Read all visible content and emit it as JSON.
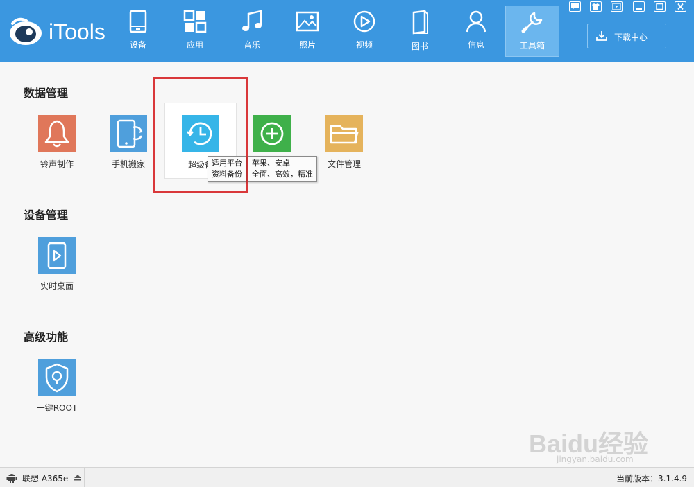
{
  "app": {
    "name": "iTools"
  },
  "nav": [
    {
      "label": "设备",
      "icon": "tablet-icon"
    },
    {
      "label": "应用",
      "icon": "apps-grid-icon"
    },
    {
      "label": "音乐",
      "icon": "music-note-icon"
    },
    {
      "label": "照片",
      "icon": "photo-icon"
    },
    {
      "label": "视频",
      "icon": "play-circle-icon"
    },
    {
      "label": "图书",
      "icon": "book-icon"
    },
    {
      "label": "信息",
      "icon": "person-icon"
    },
    {
      "label": "工具箱",
      "icon": "wrench-icon",
      "active": true
    }
  ],
  "window_controls": [
    "feedback-icon",
    "skin-icon",
    "dropdown-menu-icon",
    "minimize-icon",
    "maximize-icon",
    "close-icon"
  ],
  "download_center": {
    "label": "下载中心"
  },
  "sections": {
    "data_management": {
      "title": "数据管理",
      "tools": [
        {
          "label": "铃声制作",
          "icon": "bell-icon",
          "color": "#e0775a"
        },
        {
          "label": "手机搬家",
          "icon": "phone-transfer-icon",
          "color": "#4f9fdc"
        },
        {
          "label": "超级备",
          "icon": "clock-backup-icon",
          "color": "#36b5e8"
        },
        {
          "label": "",
          "icon": "plus-circle-icon",
          "color": "#3fb04a"
        },
        {
          "label": "文件管理",
          "icon": "folder-icon",
          "color": "#e5b35c"
        }
      ]
    },
    "device_management": {
      "title": "设备管理",
      "tools": [
        {
          "label": "实时桌面",
          "icon": "play-screen-icon",
          "color": "#4f9fdc"
        }
      ]
    },
    "advanced": {
      "title": "高级功能",
      "tools": [
        {
          "label": "一键ROOT",
          "icon": "shield-lock-icon",
          "color": "#4f9fdc"
        }
      ]
    }
  },
  "tooltips": {
    "backup": {
      "line1": "适用平台",
      "line2": "资料备份"
    },
    "platform": {
      "line1": "苹果、安卓",
      "line2": "全面、高效，精准"
    }
  },
  "status": {
    "device": "联想 A365e",
    "version": "当前版本：3.1.4.9"
  },
  "watermark": {
    "brand": "Baidu经验",
    "url": "jingyan.baidu.com"
  },
  "colors": {
    "header": "#3b97e0",
    "active_tab": "#6bb6ee",
    "highlight": "#d9383a"
  }
}
